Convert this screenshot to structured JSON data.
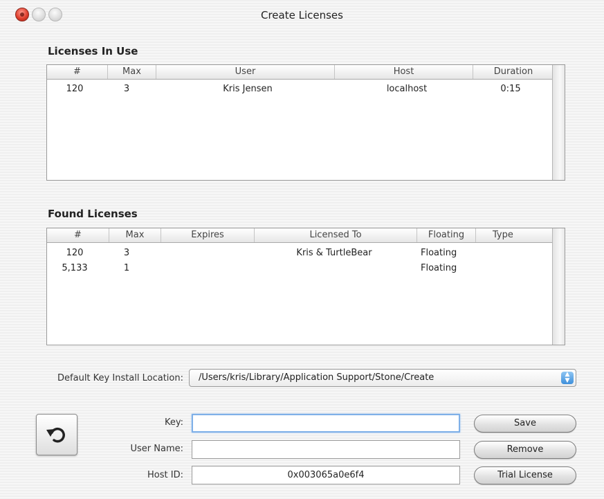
{
  "window": {
    "title": "Create Licenses"
  },
  "licenses_in_use": {
    "label": "Licenses In Use",
    "columns": [
      "#",
      "Max",
      "User",
      "Host",
      "Duration"
    ],
    "rows": [
      [
        "120",
        "3",
        "Kris Jensen",
        "localhost",
        "0:15"
      ]
    ]
  },
  "found_licenses": {
    "label": "Found Licenses",
    "columns": [
      "#",
      "Max",
      "Expires",
      "Licensed To",
      "Floating",
      "Type"
    ],
    "rows": [
      [
        "120",
        "3",
        "",
        "Kris & TurtleBear",
        "Floating",
        ""
      ],
      [
        "5,133",
        "1",
        "",
        "",
        "Floating",
        ""
      ]
    ]
  },
  "install_location": {
    "label": "Default Key Install Location:",
    "value": "/Users/kris/Library/Application Support/Stone/Create"
  },
  "form": {
    "key_label": "Key:",
    "key_value": "",
    "user_label": "User Name:",
    "user_value": "",
    "host_label": "Host ID:",
    "host_value": "0x003065a0e6f4"
  },
  "buttons": {
    "save": "Save",
    "remove": "Remove",
    "trial": "Trial License"
  },
  "icons": {
    "close": "close-icon",
    "minimize": "minimize-icon",
    "zoom": "zoom-icon",
    "reset": "undo-arrow-icon"
  },
  "colors": {
    "close_light": "#e0402e",
    "popup_arrows": "#3e8fdb",
    "focus_ring": "#7fb0e8"
  }
}
